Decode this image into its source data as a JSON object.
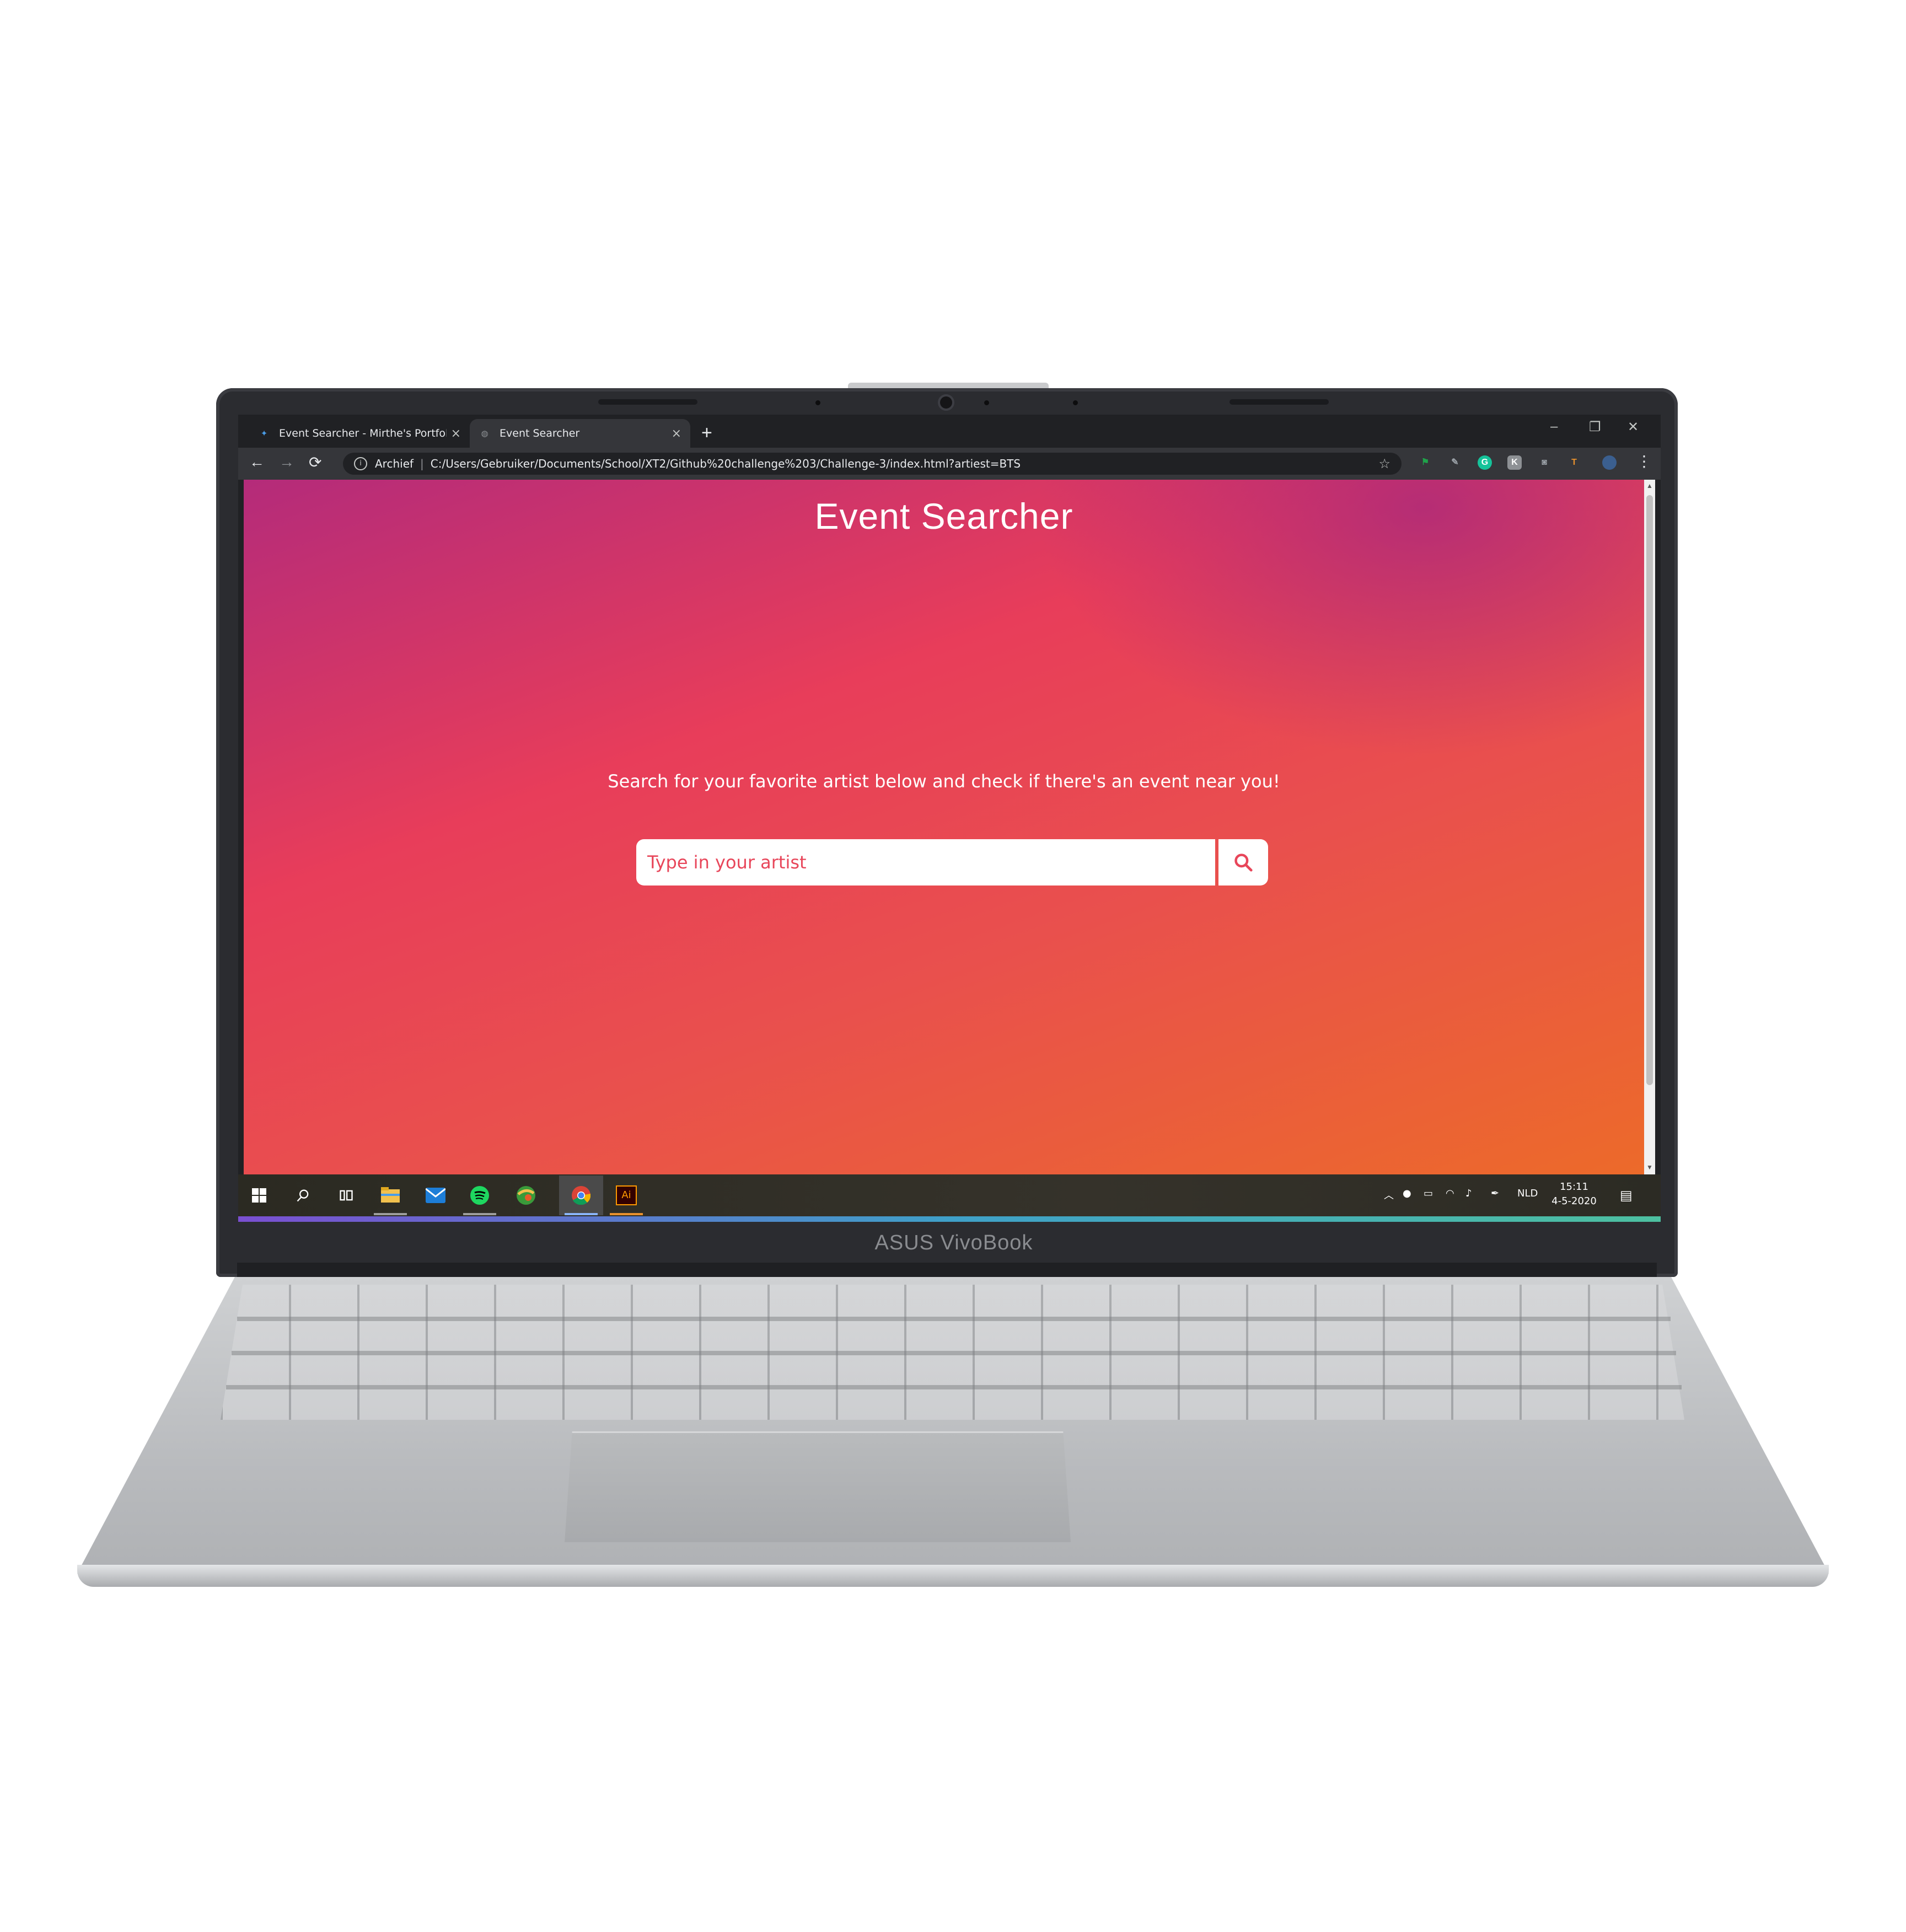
{
  "device": {
    "brand": "ASUS VivoBook"
  },
  "browser": {
    "tabs": [
      {
        "title": "Event Searcher - Mirthe's Portfolio",
        "favicon": "portfolio-icon",
        "active": false
      },
      {
        "title": "Event Searcher",
        "favicon": "globe-icon",
        "active": true
      }
    ],
    "new_tab_label": "+",
    "window_controls": {
      "minimize": "–",
      "restore": "❐",
      "close": "✕"
    },
    "nav": {
      "back": "←",
      "forward": "→",
      "reload": "⟳"
    },
    "address": {
      "info_icon": "i",
      "label": "Archief",
      "separator": "|",
      "url": "C:/Users/Gebruiker/Documents/School/XT2/Github%20challenge%203/Challenge-3/index.html?artiest=BTS",
      "bookmark_star": "☆"
    },
    "extensions": [
      {
        "name": "extension-flag-icon",
        "glyph": "⚑",
        "color": "#1fa34a"
      },
      {
        "name": "extension-pen-icon",
        "glyph": "✎",
        "color": "#5f6368"
      },
      {
        "name": "grammarly-icon",
        "glyph": "G",
        "color": "#15c39a"
      },
      {
        "name": "extension-k-icon",
        "glyph": "K",
        "color": "#8e9195"
      },
      {
        "name": "camera-extension-icon",
        "glyph": "◙",
        "color": "#8e9195"
      },
      {
        "name": "extension-t-icon",
        "glyph": "T",
        "color": "#e8912d"
      }
    ],
    "menu": "⋮"
  },
  "page": {
    "title": "Event Searcher",
    "tagline": "Search for your favorite artist below and check if there's an event near you!",
    "search": {
      "placeholder": "Type in your artist",
      "value": ""
    },
    "colors": {
      "gradient_top_right": "#9a2286",
      "gradient_mid": "#e83d5a",
      "gradient_bottom_left": "#ec6a2a",
      "accent": "#e8465a"
    }
  },
  "taskbar": {
    "apps": [
      {
        "name": "start-button",
        "icon": "windows-icon"
      },
      {
        "name": "search-button",
        "icon": "search-icon"
      },
      {
        "name": "task-view-button",
        "icon": "task-view-icon"
      },
      {
        "name": "file-explorer-app",
        "icon": "folder-icon"
      },
      {
        "name": "mail-app",
        "icon": "mail-icon"
      },
      {
        "name": "spotify-app",
        "icon": "spotify-icon"
      },
      {
        "name": "maps-app",
        "icon": "globe-app-icon"
      },
      {
        "name": "chrome-app",
        "icon": "chrome-icon"
      },
      {
        "name": "illustrator-app",
        "icon": "illustrator-icon",
        "label": "Ai"
      }
    ],
    "tray": {
      "language": "NLD",
      "time": "15:11",
      "date": "4-5-2020"
    }
  }
}
